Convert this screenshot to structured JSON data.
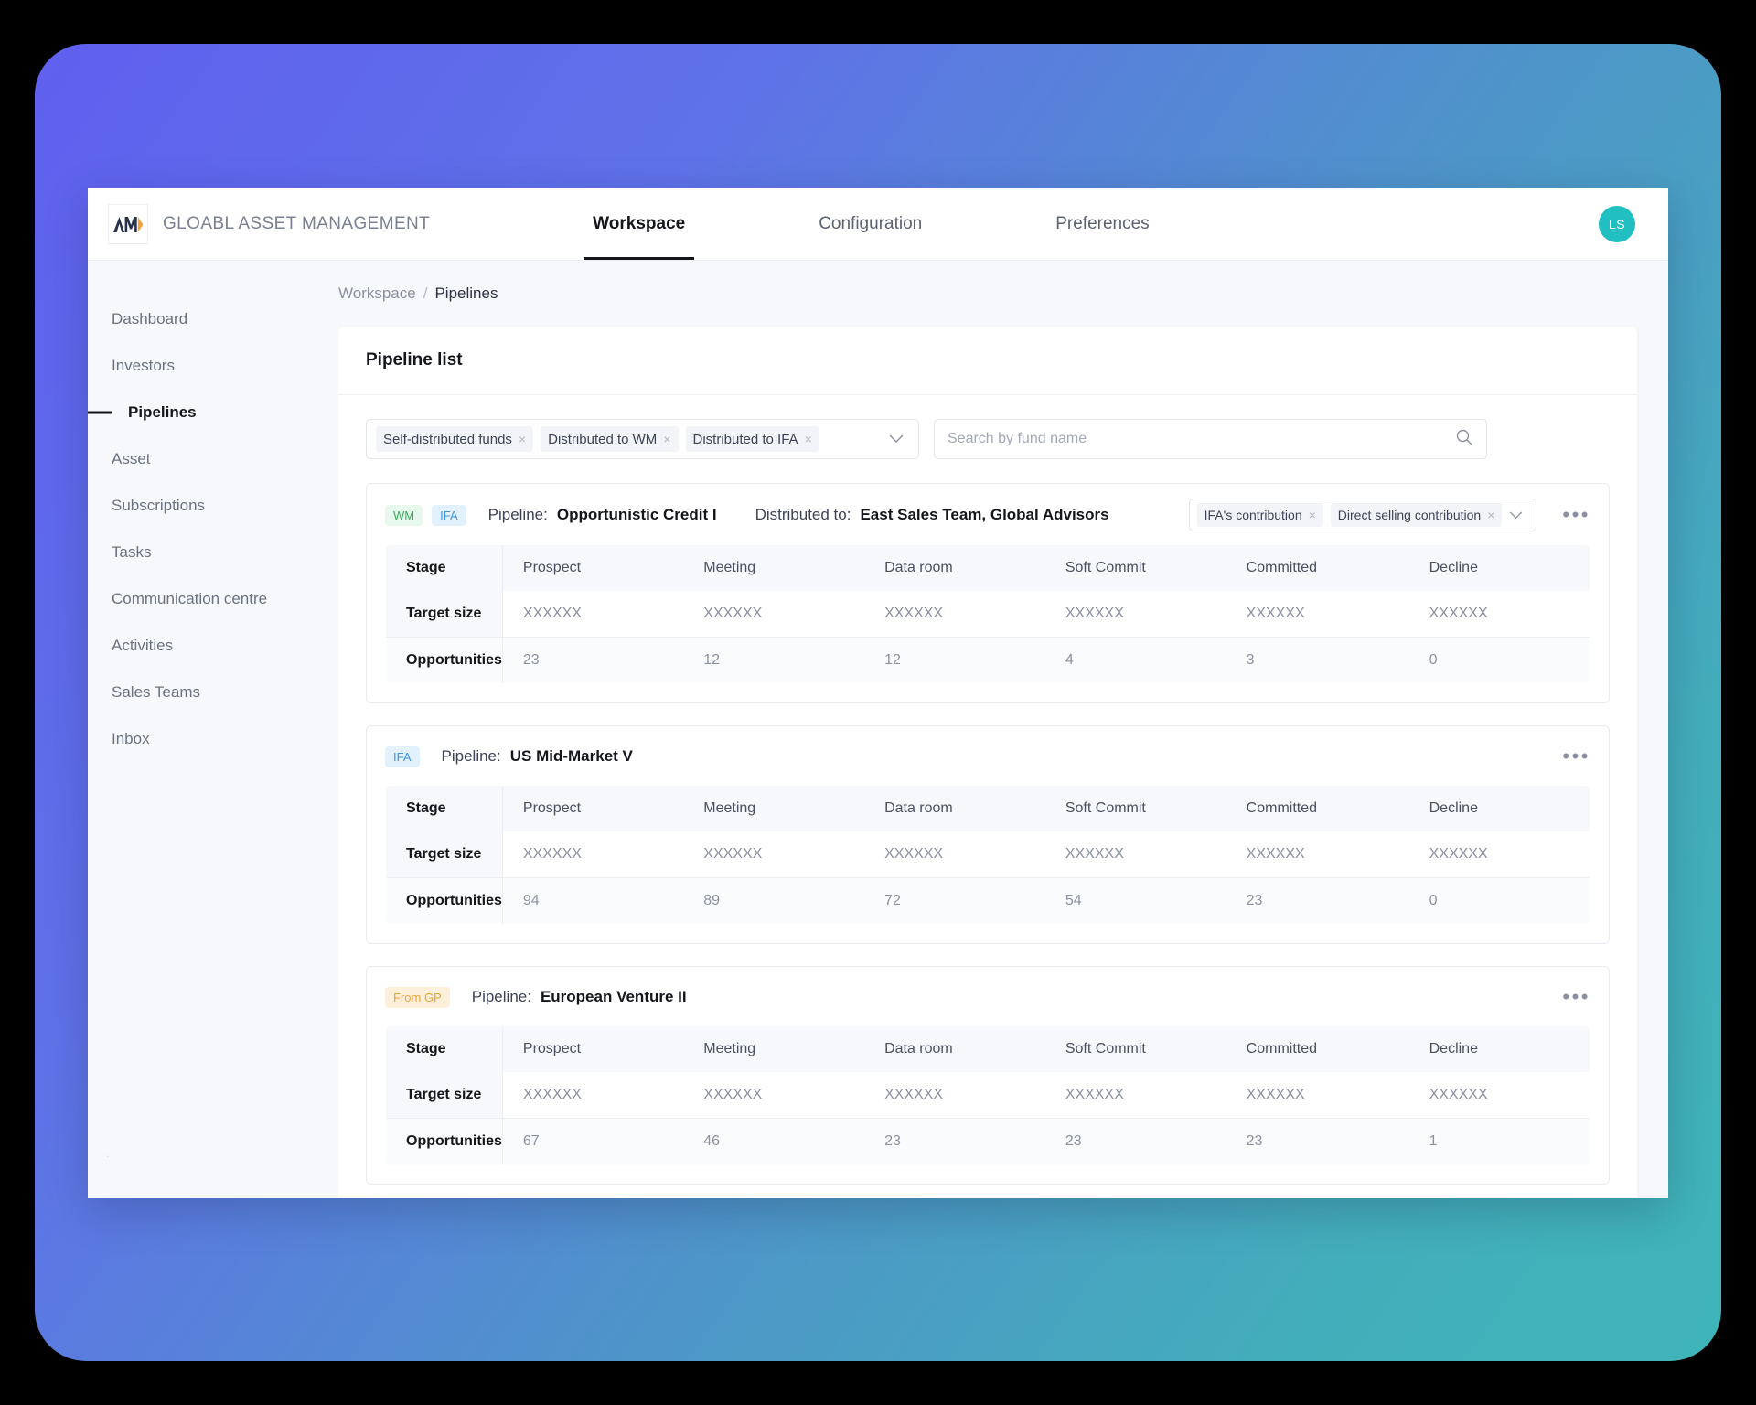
{
  "theme": {
    "gradient_start": "#5f60ef",
    "gradient_end": "#3fb5b8",
    "accent_dark": "#14161c",
    "avatar_color": "#21bfc2",
    "tag_wm_color": "#3aab5c",
    "tag_ifa_color": "#3f95e0",
    "tag_gp_color": "#e8a33c"
  },
  "topbar": {
    "logo_text": "AM",
    "brand_name": "GLOABL ASSET MANAGEMENT",
    "nav": [
      {
        "label": "Workspace",
        "active": true
      },
      {
        "label": "Configuration",
        "active": false
      },
      {
        "label": "Preferences",
        "active": false
      }
    ],
    "avatar_initials": "LS"
  },
  "sidebar": {
    "items": [
      {
        "label": "Dashboard"
      },
      {
        "label": "Investors"
      },
      {
        "label": "Pipelines"
      },
      {
        "label": "Asset"
      },
      {
        "label": "Subscriptions"
      },
      {
        "label": "Tasks"
      },
      {
        "label": "Communication centre"
      },
      {
        "label": "Activities"
      },
      {
        "label": "Sales Teams"
      },
      {
        "label": "Inbox"
      }
    ],
    "active_index": 2
  },
  "breadcrumb": {
    "root": "Workspace",
    "separator": "/",
    "current": "Pipelines"
  },
  "panel": {
    "title": "Pipeline list"
  },
  "filters": {
    "chips": [
      {
        "label": "Self-distributed funds",
        "close": "×"
      },
      {
        "label": "Distributed to WM",
        "close": "×"
      },
      {
        "label": "Distributed to IFA",
        "close": "×"
      }
    ],
    "caret_icon": "⌄",
    "search": {
      "placeholder": "Search by fund name",
      "value": "",
      "icon": "search-icon"
    }
  },
  "table_columns": [
    "Stage",
    "Prospect",
    "Meeting",
    "Data room",
    "Soft Commit",
    "Committed",
    "Decline"
  ],
  "row_labels": {
    "target": "Target size",
    "opportunities": "Opportunities"
  },
  "labels": {
    "pipeline": "Pipeline:",
    "distributed_to": "Distributed to:",
    "more_actions": "•••"
  },
  "pipelines": [
    {
      "tags": [
        {
          "text": "WM",
          "style": "wm"
        },
        {
          "text": "IFA",
          "style": "ifa"
        }
      ],
      "name": "Opportunistic Credit I",
      "has_distribution": true,
      "distributed_to": "East Sales Team,  Global Advisors",
      "contribution_chips": [
        {
          "label": "IFA's contribution",
          "close": "×"
        },
        {
          "label": "Direct selling contribution",
          "close": "×"
        }
      ],
      "target_size": [
        "XXXXXX",
        "XXXXXX",
        "XXXXXX",
        "XXXXXX",
        "XXXXXX",
        "XXXXXX"
      ],
      "opportunities": [
        "23",
        "12",
        "12",
        "4",
        "3",
        "0"
      ]
    },
    {
      "tags": [
        {
          "text": "IFA",
          "style": "ifa"
        }
      ],
      "name": "US Mid-Market V",
      "has_distribution": false,
      "distributed_to": "",
      "contribution_chips": [],
      "target_size": [
        "XXXXXX",
        "XXXXXX",
        "XXXXXX",
        "XXXXXX",
        "XXXXXX",
        "XXXXXX"
      ],
      "opportunities": [
        "94",
        "89",
        "72",
        "54",
        "23",
        "0"
      ]
    },
    {
      "tags": [
        {
          "text": "From GP",
          "style": "gp"
        }
      ],
      "name": "European Venture II",
      "has_distribution": false,
      "distributed_to": "",
      "contribution_chips": [],
      "target_size": [
        "XXXXXX",
        "XXXXXX",
        "XXXXXX",
        "XXXXXX",
        "XXXXXX",
        "XXXXXX"
      ],
      "opportunities": [
        "67",
        "46",
        "23",
        "23",
        "23",
        "1"
      ]
    }
  ]
}
